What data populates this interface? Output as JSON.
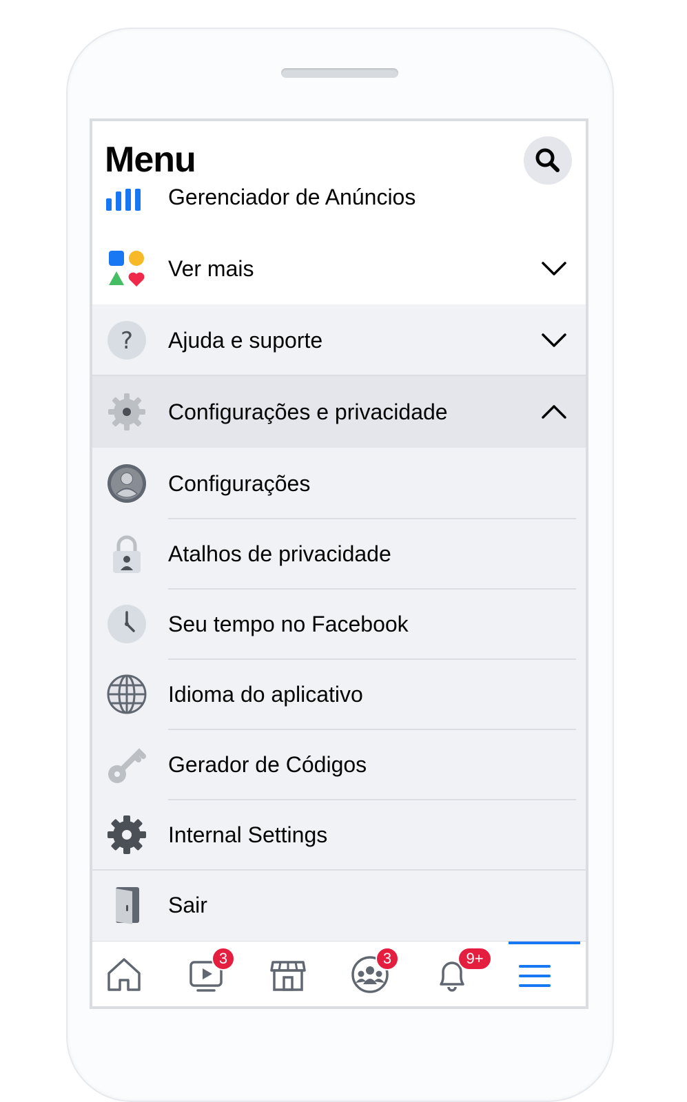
{
  "header": {
    "title": "Menu"
  },
  "rows": {
    "ads_manager": {
      "label": "Gerenciador de Anúncios"
    },
    "see_more": {
      "label": "Ver mais"
    },
    "help": {
      "label": "Ajuda e suporte"
    },
    "settings_privacy": {
      "label": "Configurações e privacidade"
    },
    "settings": {
      "label": "Configurações"
    },
    "privacy_shortcuts": {
      "label": "Atalhos de privacidade"
    },
    "time_on_facebook": {
      "label": "Seu tempo no Facebook"
    },
    "app_language": {
      "label": "Idioma do aplicativo"
    },
    "code_generator": {
      "label": "Gerador de Códigos"
    },
    "internal_settings": {
      "label": "Internal Settings"
    },
    "logout": {
      "label": "Sair"
    }
  },
  "bottom_nav": {
    "watch_badge": "3",
    "groups_badge": "3",
    "notifications_badge": "9+"
  },
  "colors": {
    "accent": "#1877f2",
    "badge": "#e41e3f",
    "surface": "#f0f2f5",
    "highlight_row": "#e4e6eb"
  }
}
